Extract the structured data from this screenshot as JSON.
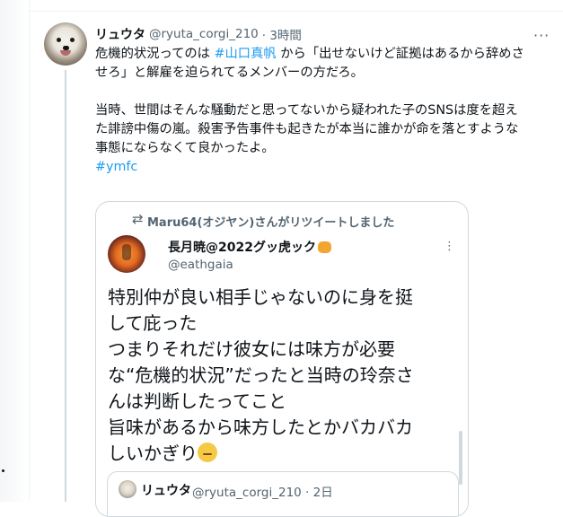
{
  "tweet": {
    "display_name": "リュウタ",
    "handle": "@ryuta_corgi_210",
    "time": "· 3時間",
    "more": "···",
    "lines": [
      [
        "危機的状況ってのは ",
        "#山口真帆",
        " から「出せないけど証拠はあるから辞めさ"
      ],
      [
        "せろ」と解雇を迫られてるメンバーの方だろ。"
      ]
    ],
    "para2": [
      "当時、世間はそんな騒動だと思ってないから疑われた子のSNSは度を超え",
      "た誹謗中傷の嵐。殺害予告事件も起きたが本当に誰かが命を落とすような",
      "事態にならなくて良かったよ。"
    ],
    "hashtag": "#ymfc"
  },
  "quote": {
    "retweet_text": "Maru64(オジヤン)さんがリツイートしました",
    "retweet_icon": "⇄",
    "display_name": "長月暁@2022グッ虎ック",
    "handle": "@eathgaia",
    "more": "⋮",
    "lines": [
      "特別仲が良い相手じゃないのに身を挺",
      "して庇った",
      "つまりそれだけ彼女には味方が必要",
      "な“危機的状況”だったと当時の玲奈さ",
      "んは判断したってこと",
      "旨味があるから味方したとかバカバカ",
      "しいかぎり"
    ]
  },
  "nested": {
    "display_name": "リュウタ",
    "handle": "@ryuta_corgi_210 · 2日"
  },
  "colors": {
    "link": "#1d9bf0",
    "muted": "#536471",
    "border": "#cfd9de"
  }
}
